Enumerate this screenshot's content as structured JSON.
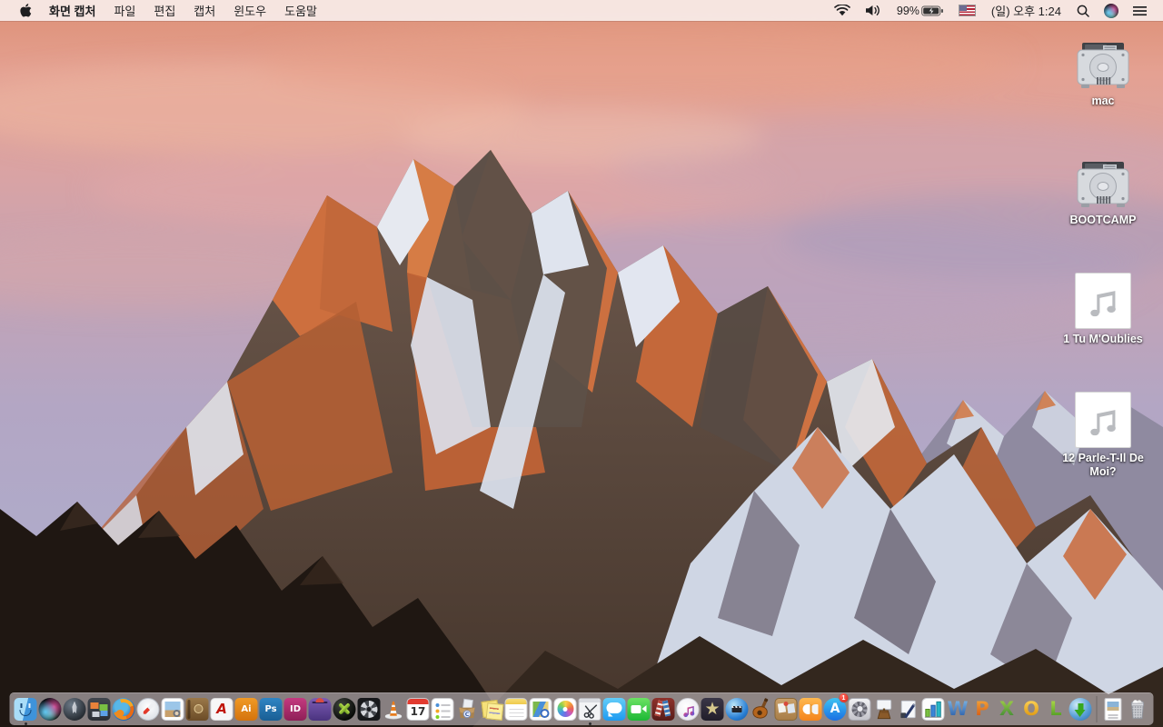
{
  "menu_bar": {
    "apple_logo": "apple-icon",
    "app_name": "화면 캡처",
    "menus": [
      "파일",
      "편집",
      "캡처",
      "윈도우",
      "도움말"
    ],
    "status": {
      "wifi": "wifi-icon",
      "volume": "volume-icon",
      "battery_percent": "99%",
      "battery": "battery-charging-icon",
      "input_source": "us-flag-icon",
      "clock": "(일) 오후 1:24",
      "spotlight": "spotlight-search-icon",
      "siri": "siri-icon",
      "notification_center": "notification-center-icon"
    }
  },
  "desktop": {
    "icons": [
      {
        "label": "mac",
        "type": "hard-drive"
      },
      {
        "label": "BOOTCAMP",
        "type": "hard-drive"
      },
      {
        "label": "1 Tu M'Oublies",
        "type": "audio-file"
      },
      {
        "label": "12 Parle-T-Il De Moi?",
        "type": "audio-file"
      }
    ]
  },
  "dock": {
    "items": [
      {
        "id": "finder",
        "running": true
      },
      {
        "id": "siri"
      },
      {
        "id": "launchpad"
      },
      {
        "id": "mission-control"
      },
      {
        "id": "firefox"
      },
      {
        "id": "safari"
      },
      {
        "id": "preview"
      },
      {
        "id": "address-book"
      },
      {
        "id": "acrobat-reader",
        "text": "A"
      },
      {
        "id": "illustrator",
        "text": "Ai"
      },
      {
        "id": "photoshop",
        "text": "Ps"
      },
      {
        "id": "indesign",
        "text": "ID"
      },
      {
        "id": "toast"
      },
      {
        "id": "x-orb-app"
      },
      {
        "id": "disk-tool"
      },
      {
        "id": "vlc"
      },
      {
        "id": "calendar",
        "text": "17"
      },
      {
        "id": "reminders"
      },
      {
        "id": "archive-box-app"
      },
      {
        "id": "stickies"
      },
      {
        "id": "notes"
      },
      {
        "id": "map-guide-app"
      },
      {
        "id": "photos"
      },
      {
        "id": "grab",
        "running": true
      },
      {
        "id": "messages"
      },
      {
        "id": "facetime"
      },
      {
        "id": "photo-booth"
      },
      {
        "id": "itunes"
      },
      {
        "id": "imovie"
      },
      {
        "id": "idvd"
      },
      {
        "id": "garageband"
      },
      {
        "id": "corkboard-app"
      },
      {
        "id": "ibooks"
      },
      {
        "id": "app-store",
        "text": "A",
        "badge": "1"
      },
      {
        "id": "system-preferences"
      },
      {
        "id": "keynote"
      },
      {
        "id": "pages"
      },
      {
        "id": "numbers"
      },
      {
        "id": "word",
        "text": "W"
      },
      {
        "id": "powerpoint",
        "text": "P"
      },
      {
        "id": "excel",
        "text": "X"
      },
      {
        "id": "outlook",
        "text": "O"
      },
      {
        "id": "lync",
        "text": "L"
      },
      {
        "id": "globe-download"
      }
    ],
    "trailing": [
      {
        "id": "image-file"
      },
      {
        "id": "trash"
      }
    ]
  },
  "colors": {
    "menu_bar_bg": "#f7ece8",
    "dock_bg": "rgba(211,203,208,0.58)",
    "sunlit_rock": "#c96a3f",
    "sky_pink": "#e4a192",
    "sky_lavender": "#b3a6c4",
    "badge_red": "#d81e12"
  }
}
